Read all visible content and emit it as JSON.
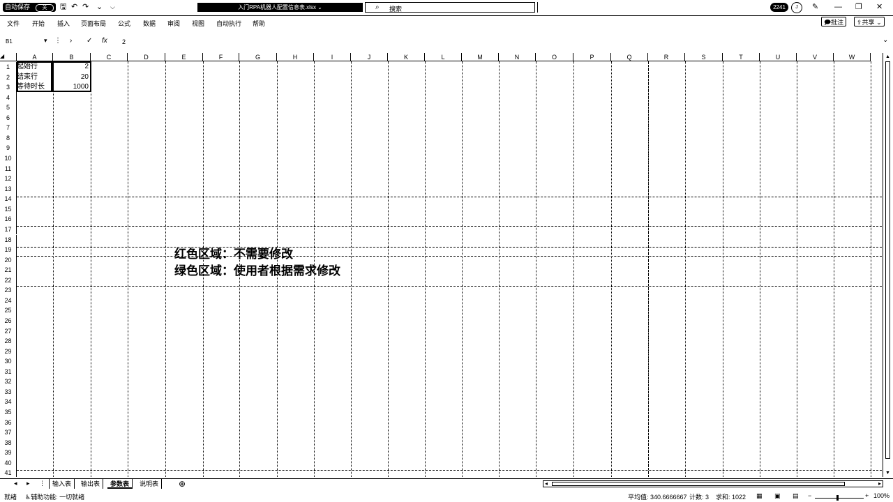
{
  "titlebar": {
    "autosave_label": "自动保存",
    "autosave_state": "关",
    "save_icon": "save-icon",
    "undo_icon": "undo-icon",
    "redo_icon": "redo-icon",
    "customize_label": "⌵",
    "doc_title": "入门RPA机器人配置信息表.xlsx ⌄",
    "search_placeholder": "搜索",
    "user_badge": "2241",
    "avatar_initial": "J",
    "min_label": "—",
    "restore_label": "❐",
    "close_label": "✕",
    "ribbon_opt_label": "⋯"
  },
  "menu": [
    "文件",
    "开始",
    "插入",
    "页面布局",
    "公式",
    "数据",
    "审阅",
    "视图",
    "自动执行",
    "帮助"
  ],
  "ribbon_buttons": {
    "comments": "批注",
    "share": "共享"
  },
  "formula_bar": {
    "name_box": "B1",
    "cancel": "✕",
    "enter": "✓",
    "fx": "fx",
    "value": "2"
  },
  "columns": [
    "A",
    "B",
    "C",
    "D",
    "E",
    "F",
    "G",
    "H",
    "I",
    "J",
    "K",
    "L",
    "M",
    "N",
    "O",
    "P",
    "Q",
    "R",
    "S",
    "T",
    "U",
    "V",
    "W"
  ],
  "rows": [
    "1",
    "2",
    "3",
    "4",
    "5",
    "6",
    "7",
    "8",
    "9",
    "10",
    "11",
    "12",
    "13",
    "14",
    "15",
    "16",
    "17",
    "18",
    "19",
    "20",
    "21",
    "22",
    "23",
    "24",
    "25",
    "26",
    "27",
    "28",
    "29",
    "30",
    "31",
    "32",
    "33",
    "34",
    "35",
    "36",
    "37",
    "38",
    "39",
    "40",
    "41"
  ],
  "cells": {
    "A1": "起始行",
    "B1": "2",
    "A2": "结束行",
    "B2": "20",
    "A3": "等待时长",
    "B3": "1000"
  },
  "legend": {
    "red": "红色区域：不需要修改",
    "green": "绿色区域：使用者根据需求修改"
  },
  "sheet_tabs": [
    {
      "label": "输入表",
      "active": false
    },
    {
      "label": "输出表",
      "active": false
    },
    {
      "label": "参数表",
      "active": true
    },
    {
      "label": "说明表",
      "active": false
    }
  ],
  "add_sheet": "⊕",
  "status": {
    "ready": "就绪",
    "accessibility": "辅助功能: 一切就绪",
    "average": "平均值: 340.6666667",
    "count": "计数: 3",
    "sum": "求和: 1022",
    "zoom": "100%",
    "zoom_minus": "−",
    "zoom_plus": "+"
  }
}
